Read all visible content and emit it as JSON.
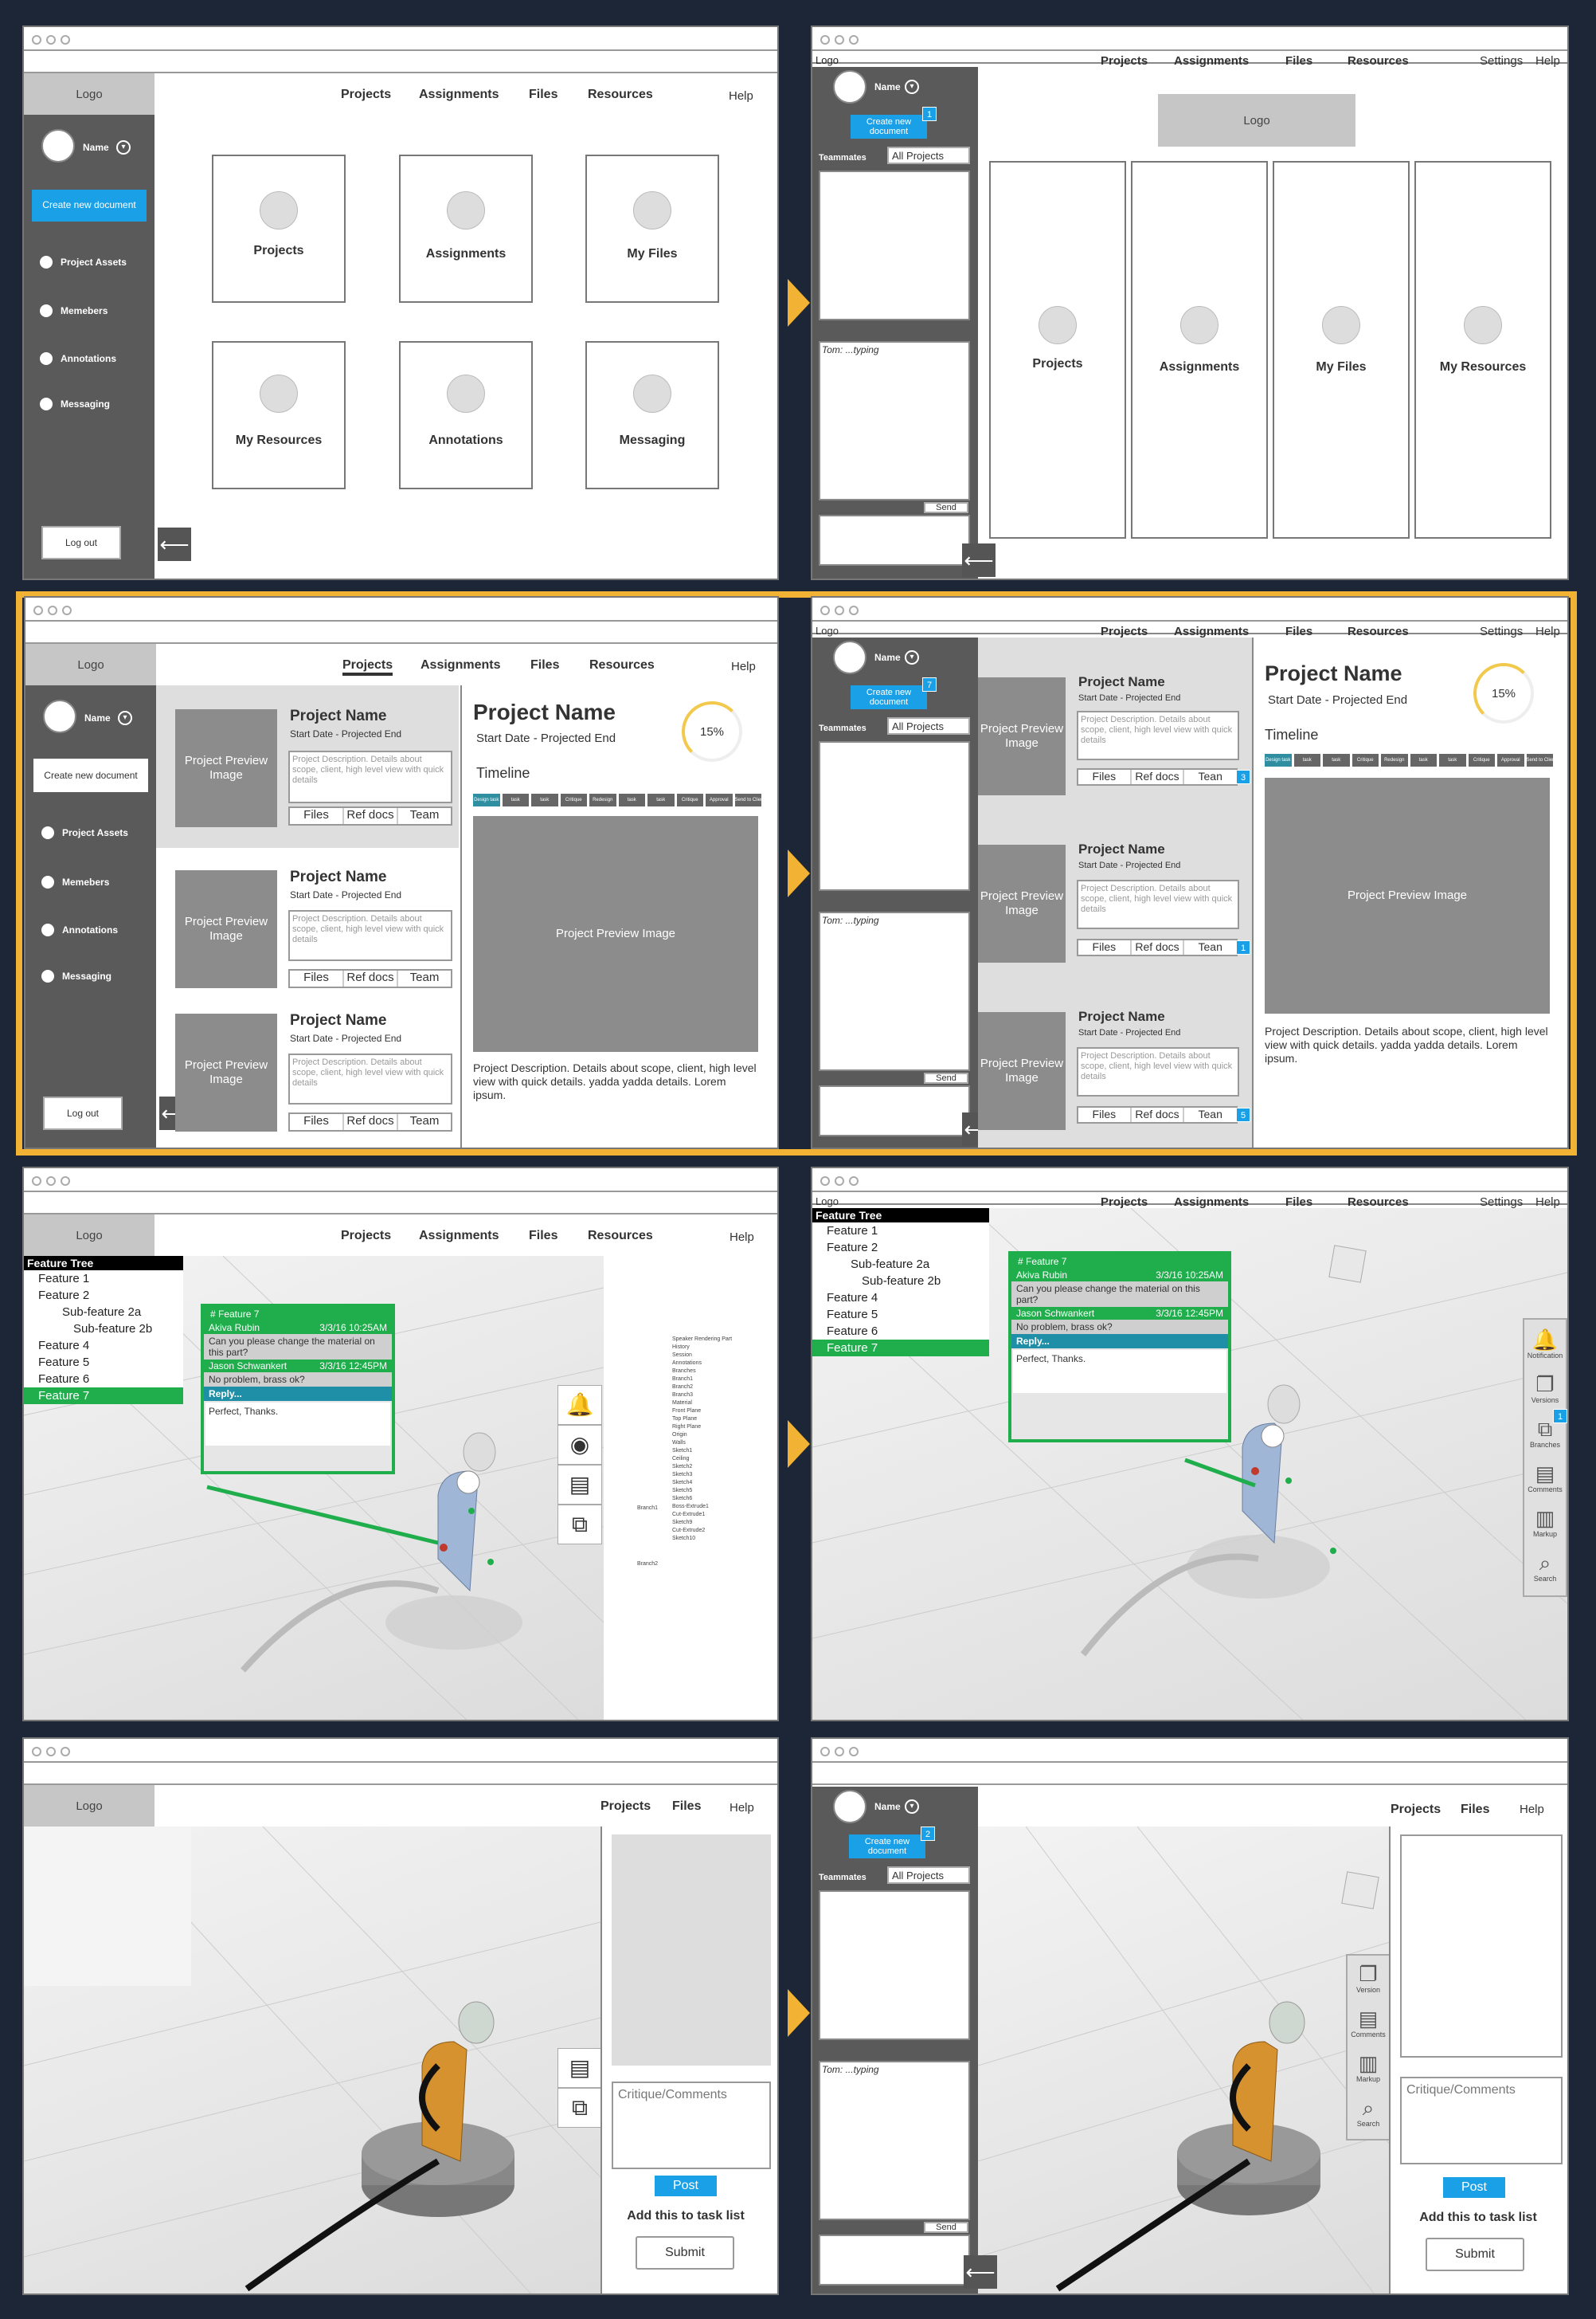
{
  "common": {
    "logo": "Logo",
    "help": "Help",
    "settings": "Settings",
    "nav": [
      "Projects",
      "Assignments",
      "Files",
      "Resources"
    ],
    "user_name": "Name",
    "create_doc": "Create new document",
    "create_doc_2": "Create new document",
    "logout": "Log out",
    "teammates": "Teammates",
    "all_projects": "All Projects",
    "typing": "Tom: ...typing",
    "send": "Send",
    "sidebar_items": [
      "Project Assets",
      "Memebers",
      "Annotations",
      "Messaging"
    ]
  },
  "panel1": {
    "cards": [
      "Projects",
      "Assignments",
      "My Files",
      "My Resources",
      "Annotations",
      "Messaging"
    ]
  },
  "panel2": {
    "badge": "1",
    "cards": [
      "Projects",
      "Assignments",
      "My Files",
      "My Resources"
    ]
  },
  "panel3": {
    "project": {
      "name": "Project Name",
      "dates": "Start Date - Projected End",
      "preview": "Project Preview Image",
      "desc": "Project Description. Details about scope, client, high level view with quick details",
      "tabs": [
        "Files",
        "Ref docs",
        "Team"
      ]
    },
    "detail": {
      "name": "Project Name",
      "dates": "Start Date - Projected End",
      "progress": "15%",
      "timeline": "Timeline",
      "timeline_steps": [
        "Design task",
        "task",
        "task",
        "Critique",
        "Redesign",
        "task",
        "task",
        "Critique",
        "Approval",
        "Send to Client"
      ],
      "preview": "Project Preview Image",
      "desc": "Project Description. Details about scope, client, high level view with quick details. yadda yadda details. Lorem ipsum."
    }
  },
  "panel4": {
    "badge": "7",
    "tabs_short": [
      "Files",
      "Ref docs",
      "Tean"
    ],
    "row_badges": [
      "3",
      "1",
      "5"
    ]
  },
  "panel5": {
    "feature_tree_title": "Feature Tree",
    "features": [
      "Feature 1",
      "Feature 2",
      "Sub-feature 2a",
      "Sub-feature 2b",
      "Feature 4",
      "Feature 5",
      "Feature 6",
      "Feature 7"
    ],
    "comment": {
      "title": "# Feature 7",
      "user1": "Akiva Rubin",
      "time1": "3/3/16 10:25AM",
      "msg1": "Can you please change the material on this part?",
      "user2": "Jason Schwankert",
      "time2": "3/3/16 12:45PM",
      "msg2": "No problem, brass ok?",
      "reply": "Reply...",
      "draft": "Perfect, Thanks."
    },
    "tree_items": [
      "Speaker Rendering Part",
      "History",
      "Session",
      "Annotations",
      "Branches",
      "Branch1",
      "Branch2",
      "Branch3",
      "Material",
      "Front Plane",
      "Top Plane",
      "Right Plane",
      "Origin",
      "Walls",
      "Sketch1",
      "Ceiling",
      "Sketch2",
      "Sketch3",
      "Sketch4",
      "Sketch5",
      "Sketch6",
      "Boss-Extrude1",
      "Cut-Extrude1",
      "Sketch9",
      "Cut-Extrude2",
      "Sketch10"
    ],
    "branch_labels": [
      "Branch1",
      "Branch2"
    ]
  },
  "panel6": {
    "tools": [
      "Notification",
      "Versions",
      "Branches",
      "Comments",
      "Markup",
      "Search"
    ],
    "badge": "1"
  },
  "panel7": {
    "nav": [
      "Projects",
      "Files"
    ],
    "critique": "Critique/Comments",
    "post": "Post",
    "add_task": "Add this to task list",
    "submit": "Submit"
  },
  "panel8": {
    "badge": "2",
    "tools": [
      "Version",
      "Comments",
      "Markup",
      "Search"
    ]
  },
  "colors": {
    "background": "#1c2637",
    "accent_blue": "#1aa0e6",
    "highlight": "#f2b233",
    "comment_green": "#1fae4b",
    "sidebar": "#5a5a5a"
  }
}
